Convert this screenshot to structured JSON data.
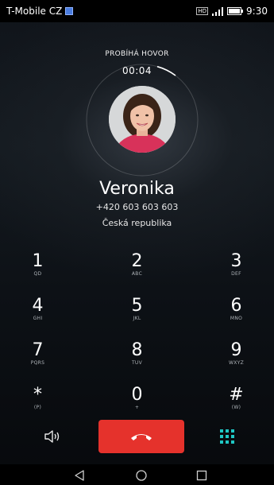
{
  "status_bar": {
    "carrier": "T-Mobile CZ",
    "hd_badge": "HD",
    "clock": "9:30"
  },
  "call": {
    "status": "PROBÍHÁ HOVOR",
    "timer": "00:04",
    "contact_name": "Veronika",
    "number": "+420 603 603 603",
    "country": "Česká republika"
  },
  "dialpad": {
    "keys": [
      {
        "digit": "1",
        "letters": "QD"
      },
      {
        "digit": "2",
        "letters": "ABC"
      },
      {
        "digit": "3",
        "letters": "DEF"
      },
      {
        "digit": "4",
        "letters": "GHI"
      },
      {
        "digit": "5",
        "letters": "JKL"
      },
      {
        "digit": "6",
        "letters": "MNO"
      },
      {
        "digit": "7",
        "letters": "PQRS"
      },
      {
        "digit": "8",
        "letters": "TUV"
      },
      {
        "digit": "9",
        "letters": "WXYZ"
      },
      {
        "digit": "*",
        "letters": "(P)"
      },
      {
        "digit": "0",
        "letters": "+"
      },
      {
        "digit": "#",
        "letters": "(W)"
      }
    ]
  },
  "colors": {
    "end_call": "#e5322c",
    "dialpad_toggle": "#1fc7c4",
    "sim_badge": "#4a7de0"
  },
  "icons": {
    "speaker": "speaker-icon",
    "end_call": "phone-hangup-icon",
    "dialpad_toggle": "dialpad-grid-icon",
    "nav_back": "back-triangle-icon",
    "nav_home": "home-circle-icon",
    "nav_recents": "recents-square-icon"
  }
}
